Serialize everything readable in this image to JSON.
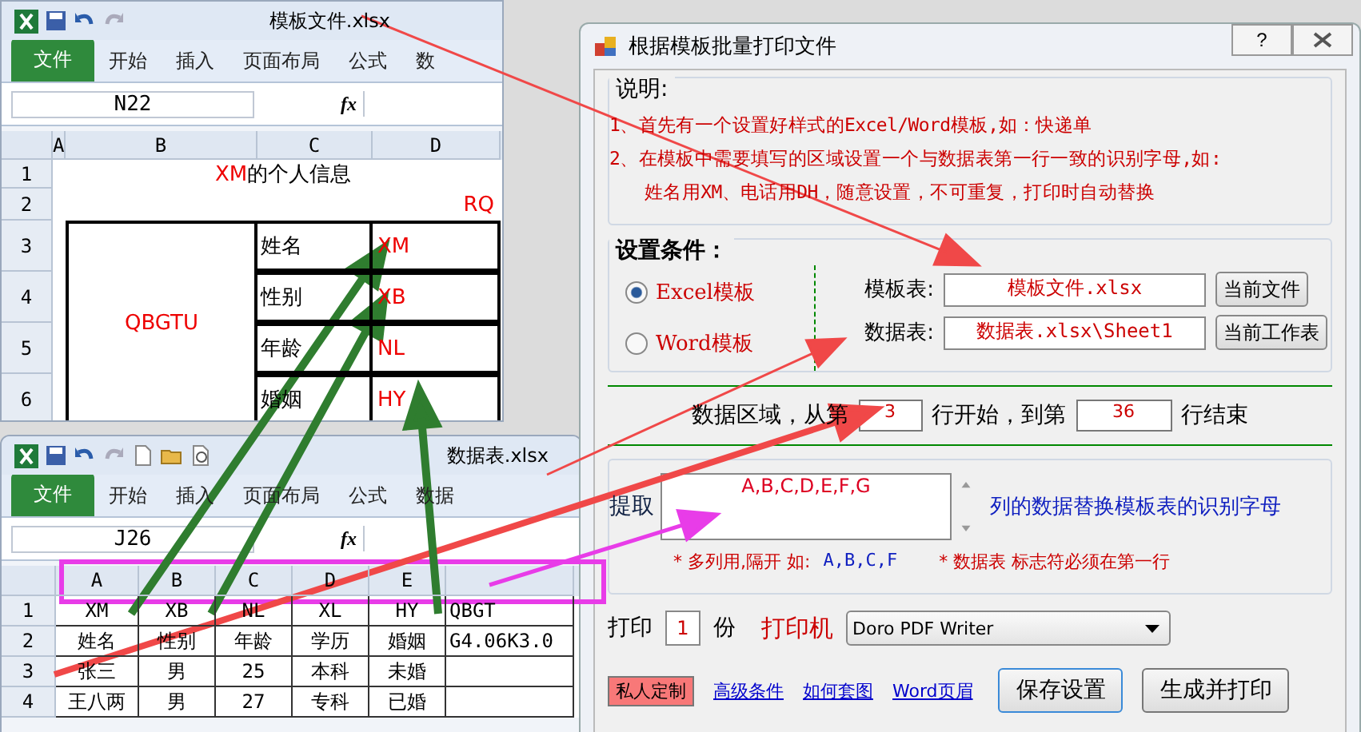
{
  "template_window": {
    "title": "模板文件.xlsx",
    "tabs": [
      {
        "label": "文件",
        "selected": true
      },
      {
        "label": "开始",
        "selected": false
      },
      {
        "label": "插入",
        "selected": false
      },
      {
        "label": "页面布局",
        "selected": false
      },
      {
        "label": "公式",
        "selected": false
      },
      {
        "label": "数",
        "selected": false
      }
    ],
    "name_box": "N22",
    "formula_label": "fx",
    "columns": [
      "A",
      "B",
      "C",
      "D"
    ],
    "row_numbers": [
      "1",
      "2",
      "3",
      "4",
      "5",
      "6"
    ],
    "heading": {
      "code": "XM",
      "text": "的个人信息"
    },
    "date_code": "RQ",
    "photo_code": "QBGTU",
    "fields": [
      {
        "label": "姓名",
        "code": "XM"
      },
      {
        "label": "性别",
        "code": "XB"
      },
      {
        "label": "年龄",
        "code": "NL"
      },
      {
        "label": "婚姻",
        "code": "HY"
      }
    ]
  },
  "data_window": {
    "title": "数据表.xlsx",
    "tabs": [
      {
        "label": "文件",
        "selected": true
      },
      {
        "label": "开始",
        "selected": false
      },
      {
        "label": "插入",
        "selected": false
      },
      {
        "label": "页面布局",
        "selected": false
      },
      {
        "label": "公式",
        "selected": false
      },
      {
        "label": "数据",
        "selected": false
      }
    ],
    "name_box": "J26",
    "formula_label": "fx",
    "columns": [
      "A",
      "B",
      "C",
      "D",
      "E"
    ],
    "rows": [
      {
        "number": "1",
        "cells": [
          "XM",
          "XB",
          "NL",
          "XL",
          "HY",
          "QBGT"
        ]
      },
      {
        "number": "2",
        "cells": [
          "姓名",
          "性别",
          "年龄",
          "学历",
          "婚姻",
          "G4.06K3.0"
        ]
      },
      {
        "number": "3",
        "cells": [
          "张三",
          "男",
          "25",
          "本科",
          "未婚"
        ]
      },
      {
        "number": "4",
        "cells": [
          "王八两",
          "男",
          "27",
          "专科",
          "已婚"
        ]
      }
    ]
  },
  "dialog": {
    "title": "根据模板批量打印文件",
    "help": "?",
    "notes_title": "说明:",
    "notes": [
      "1、首先有一个设置好样式的Excel/Word模板,如：快递单",
      "2、在模板中需要填写的区域设置一个与数据表第一行一致的识别字母,如:",
      "姓名用XM、电话用DH，随意设置，不可重复，打印时自动替换"
    ],
    "settings_title": "设置条件：",
    "template_types": [
      {
        "label": "Excel模板",
        "selected": true
      },
      {
        "label": "Word模板",
        "selected": false
      }
    ],
    "files": [
      {
        "label": "模板表:",
        "value": "模板文件.xlsx",
        "button": "当前文件"
      },
      {
        "label": "数据表:",
        "value": "数据表.xlsx\\Sheet1",
        "button": "当前工作表"
      }
    ],
    "range": {
      "prefix": "数据区域，从第",
      "start": "3",
      "middle": "行开始，到第",
      "end": "36",
      "suffix": "行结束"
    },
    "extract": {
      "label": "提取",
      "value": "A,B,C,D,E,F,G",
      "hint": "列的数据替换模板表的识别字母",
      "note": "* 多列用,隔开  如:",
      "example": "A,B,C,F",
      "rule": "* 数据表  标志符必须在第一行"
    },
    "print": {
      "label": "打印",
      "copies": "1",
      "unit": "份",
      "printer_label": "打印机",
      "printer": "Doro PDF Writer"
    },
    "custom_button": "私人定制",
    "links": [
      "高级条件",
      "如何套图",
      "Word页眉"
    ],
    "buttons": [
      "保存设置",
      "生成并打印"
    ]
  }
}
